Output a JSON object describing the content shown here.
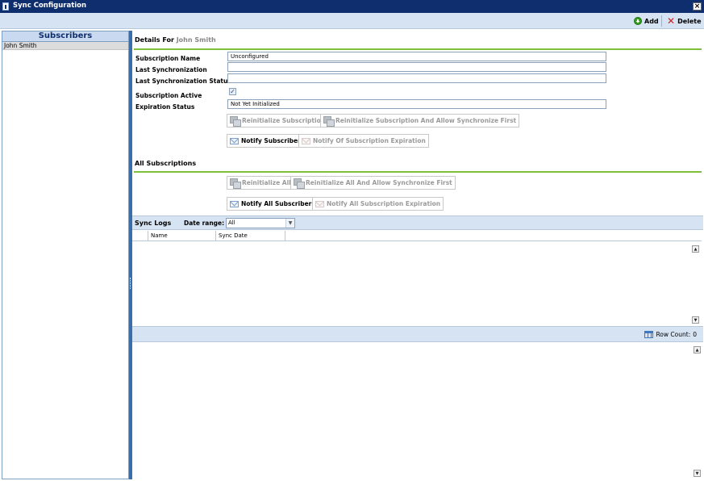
{
  "window": {
    "title": "Sync Configuration"
  },
  "toolbar": {
    "add_label": "Add",
    "delete_label": "Delete"
  },
  "sidebar": {
    "header": "Subscribers",
    "items": [
      {
        "label": "John Smith",
        "selected": true
      }
    ]
  },
  "details": {
    "title_prefix": "Details For",
    "subscriber_name": "John Smith",
    "fields": {
      "subscription_name_label": "Subscription Name",
      "subscription_name_value": "Unconfigured",
      "last_sync_label": "Last Synchronization",
      "last_sync_value": "",
      "last_sync_status_label": "Last Synchronization Status",
      "last_sync_status_value": "",
      "subscription_active_label": "Subscription Active",
      "subscription_active_checked": true,
      "checkbox_glyph": "✓",
      "expiration_status_label": "Expiration Status",
      "expiration_status_value": "Not Yet Initialized"
    },
    "buttons": {
      "reinitialize": "Reinitialize Subscription",
      "reinitialize_sync_first": "Reinitialize Subscription And Allow Synchronize First",
      "notify_subscriber": "Notify Subscriber",
      "notify_expiration": "Notify Of Subscription Expiration"
    }
  },
  "all_subscriptions": {
    "title": "All Subscriptions",
    "buttons": {
      "reinitialize_all": "Reinitialize All",
      "reinitialize_all_sync_first": "Reinitialize All And Allow Synchronize First",
      "notify_all": "Notify All Subscribers",
      "notify_all_expiration": "Notify All Subscription Expiration"
    }
  },
  "sync_logs": {
    "title": "Sync Logs",
    "date_range_label": "Date range:",
    "date_range_value": "All",
    "columns": [
      "Name",
      "Sync Date"
    ],
    "rows": [],
    "row_count_label": "Row Count:",
    "row_count": "0"
  },
  "colors": {
    "titlebar": "#0f2e6e",
    "toolbar": "#d6e3f3",
    "accent_rule": "#7fbf3a",
    "add_green": "#37a020",
    "delete_red": "#d21d1d"
  },
  "icons": {
    "add": "add-circle-icon",
    "delete": "delete-x-icon",
    "reinitialize": "reinitialize-icon",
    "notify": "envelope-icon",
    "row_count": "table-icon",
    "scroll_up": "scroll-up-icon",
    "scroll_down": "scroll-down-icon",
    "dropdown": "chevron-down-icon",
    "close": "close-icon"
  }
}
